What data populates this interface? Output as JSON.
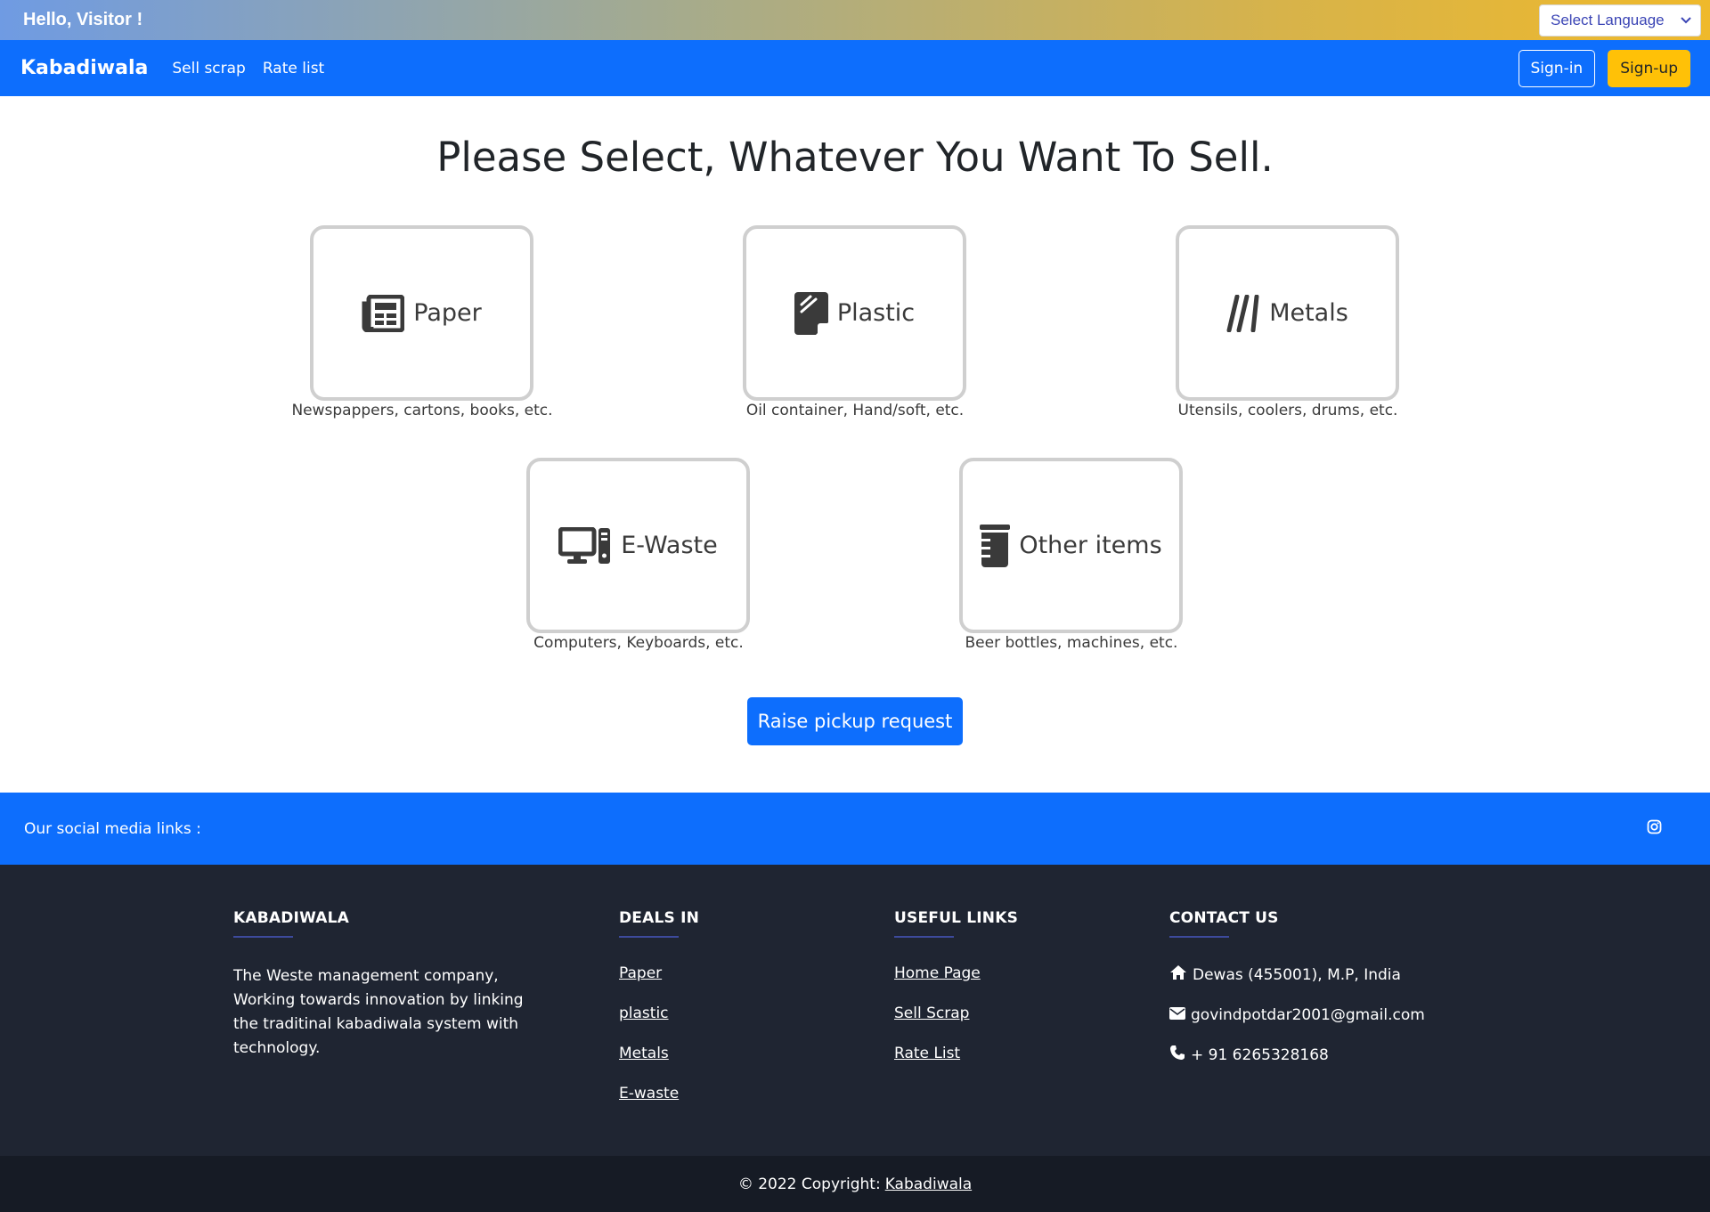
{
  "topbar": {
    "greeting": "Hello, Visitor !",
    "language_select": "Select Language"
  },
  "navbar": {
    "brand": "Kabadiwala",
    "links": [
      "Sell scrap",
      "Rate list"
    ],
    "signin": "Sign-in",
    "signup": "Sign-up"
  },
  "main": {
    "heading": "Please Select, Whatever You Want To Sell.",
    "categories": [
      {
        "label": "Paper",
        "icon": "newspaper-icon",
        "desc": "Newspappers, cartons, books, etc."
      },
      {
        "label": "Plastic",
        "icon": "note-icon",
        "desc": "Oil container, Hand/soft, etc."
      },
      {
        "label": "Metals",
        "icon": "rods-icon",
        "desc": "Utensils, coolers, drums, etc."
      },
      {
        "label": "E-Waste",
        "icon": "desktop-computer-icon",
        "desc": "Computers, Keyboards, etc."
      },
      {
        "label": "Other items",
        "icon": "jar-icon",
        "desc": "Beer bottles, machines, etc."
      }
    ],
    "raise_button": "Raise pickup request"
  },
  "social": {
    "label": "Our social media links :",
    "icon": "instagram-icon"
  },
  "footer": {
    "about": {
      "title": "KABADIWALA",
      "text": "The Weste management company, Working towards innovation by linking the traditinal kabadiwala system with technology."
    },
    "deals": {
      "title": "DEALS IN",
      "links": [
        "Paper",
        "plastic",
        "Metals",
        "E-waste"
      ]
    },
    "useful": {
      "title": "USEFUL LINKS",
      "links": [
        "Home Page",
        "Sell Scrap",
        "Rate List"
      ]
    },
    "contact": {
      "title": "CONTACT US",
      "address": "Dewas (455001), M.P, India",
      "email": "govindpotdar2001@gmail.com",
      "phone": "+ 91 6265328168"
    }
  },
  "copyright": {
    "text": "© 2022 Copyright:",
    "link": "Kabadiwala"
  },
  "colors": {
    "primary": "#0d6efd",
    "warning": "#ffc107",
    "footer_bg": "#1f2532",
    "copyright_bg": "#161b25"
  }
}
